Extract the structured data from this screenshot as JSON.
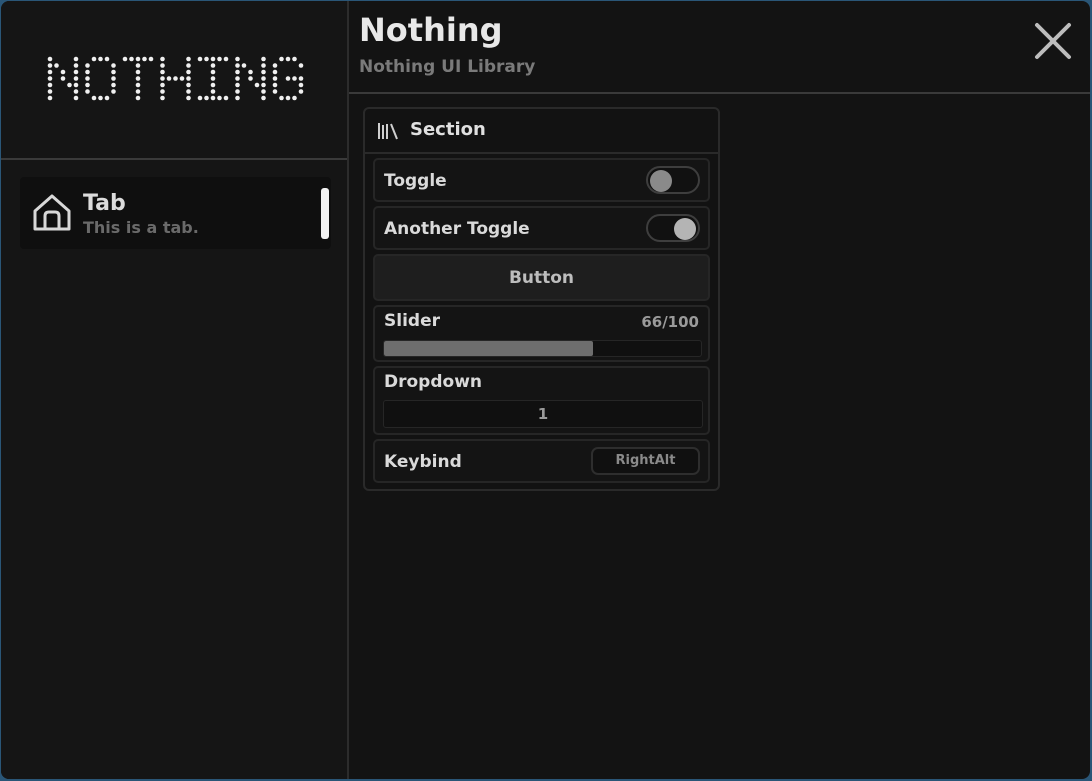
{
  "brand": {
    "logo_text": "NOTHING"
  },
  "header": {
    "title": "Nothing",
    "subtitle": "Nothing UI Library"
  },
  "sidebar": {
    "tabs": [
      {
        "title": "Tab",
        "description": "This is a tab.",
        "icon": "home-icon",
        "selected": true
      }
    ]
  },
  "section": {
    "title": "Section",
    "icon": "library-icon",
    "toggle1": {
      "label": "Toggle",
      "on": false
    },
    "toggle2": {
      "label": "Another Toggle",
      "on": true
    },
    "button": {
      "label": "Button"
    },
    "slider": {
      "label": "Slider",
      "value_text": "66/100",
      "value": 66,
      "max": 100
    },
    "dropdown": {
      "label": "Dropdown",
      "selected": "1"
    },
    "keybind": {
      "label": "Keybind",
      "key": "RightAlt"
    }
  },
  "colors": {
    "window_bg": "#131313",
    "sidebar_bg": "#151515",
    "indicator": "#f2f2f2",
    "slider_fill": "#6e6e6e"
  }
}
